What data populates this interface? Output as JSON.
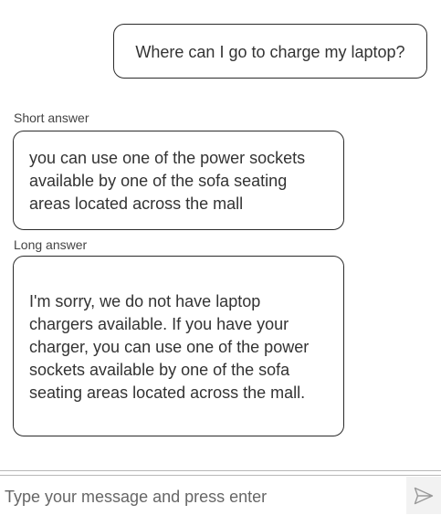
{
  "conversation": {
    "user_message": "Where can I go to charge my laptop?",
    "short_answer": {
      "label": "Short answer",
      "lines": [
        "you can use one of the power sockets",
        "available by one of the sofa seating",
        "areas located across the mall"
      ]
    },
    "long_answer": {
      "label": "Long answer",
      "lines": [
        "I'm sorry, we do not have laptop",
        "chargers available. If you have your",
        "charger, you can use one of the power",
        "sockets available by one of the sofa",
        "seating areas located across the mall."
      ]
    }
  },
  "composer": {
    "placeholder": "Type your message and press enter",
    "value": "",
    "send_icon": "send-icon"
  },
  "colors": {
    "bubble_border": "#2b2b2b",
    "text": "#333333",
    "send_button_bg": "#f2f2f2",
    "send_icon": "#999999",
    "divider": "#b8b8b8"
  }
}
